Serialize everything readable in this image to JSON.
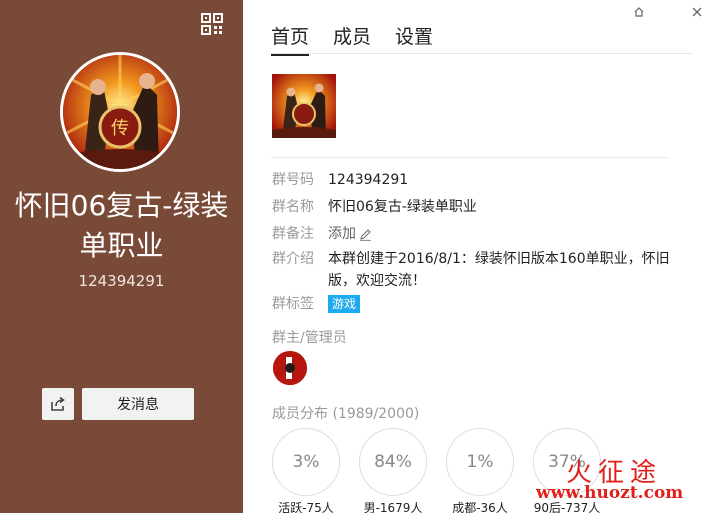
{
  "left": {
    "group_name": "怀旧06复古-绿装单职业",
    "group_id": "124394291",
    "send_message": "发消息"
  },
  "tabs": [
    {
      "label": "首页",
      "active": true
    },
    {
      "label": "成员",
      "active": false
    },
    {
      "label": "设置",
      "active": false
    }
  ],
  "info": {
    "number_label": "群号码",
    "number_value": "124394291",
    "name_label": "群名称",
    "name_value": "怀旧06复古-绿装单职业",
    "remark_label": "群备注",
    "remark_value": "添加",
    "intro_label": "群介绍",
    "intro_value": "本群创建于2016/8/1：绿装怀旧版本160单职业，怀旧版，欢迎交流！",
    "tags_label": "群标签",
    "tag": "游戏"
  },
  "admins_title": "群主/管理员",
  "members": {
    "title": "成员分布 (1989/2000)",
    "stats": [
      {
        "value": "3%",
        "label": "活跃-75人"
      },
      {
        "value": "84%",
        "label": "男-1679人"
      },
      {
        "value": "1%",
        "label": "成都-36人"
      },
      {
        "value": "37%",
        "label": "90后-737人"
      }
    ]
  },
  "watermark": {
    "text": "火征途",
    "url": "www.huozt.com"
  },
  "colors": {
    "left_bg": "#7a4a38",
    "tag_bg": "#1eaaf1",
    "watermark": "#e0201a"
  }
}
